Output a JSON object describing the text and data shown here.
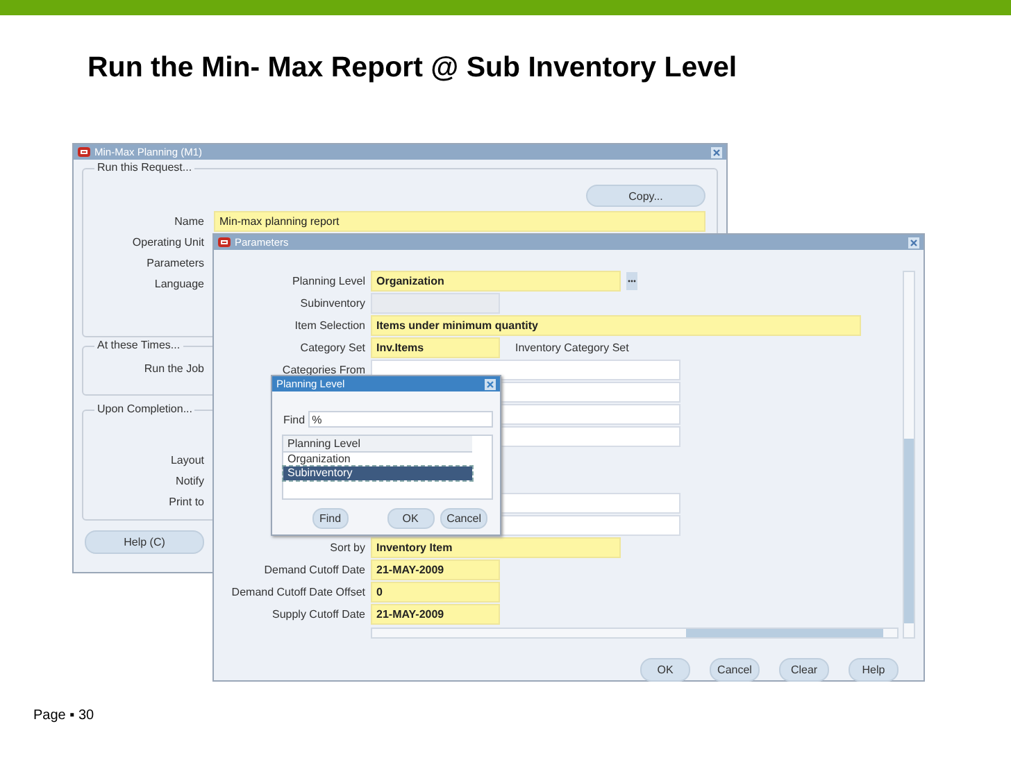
{
  "slide": {
    "title": "Run the Min- Max Report @ Sub Inventory Level",
    "footer": "Page ▪ 30"
  },
  "request_window": {
    "title": "Min-Max Planning (M1)",
    "copy_button": "Copy...",
    "help_button": "Help (C)",
    "sections": [
      {
        "heading": "Run this Request...",
        "fields": [
          {
            "label": "Name",
            "value": "Min-max planning report"
          },
          {
            "label": "Operating Unit"
          },
          {
            "label": "Parameters"
          },
          {
            "label": "Language"
          }
        ]
      },
      {
        "heading": "At these Times...",
        "fields": [
          {
            "label": "Run the Job"
          }
        ]
      },
      {
        "heading": "Upon Completion...",
        "fields": [
          {
            "label": "Layout"
          },
          {
            "label": "Notify"
          },
          {
            "label": "Print to"
          }
        ]
      }
    ]
  },
  "parameters_window": {
    "title": "Parameters",
    "rows": [
      {
        "label": "Planning Level",
        "value": "Organization",
        "required": true,
        "disabled": false,
        "kind": "medium",
        "lov": true,
        "group_start": false
      },
      {
        "label": "Subinventory",
        "required": false,
        "disabled": true,
        "kind": "short",
        "lov": false,
        "group_start": false
      },
      {
        "label": "Item Selection",
        "value": "Items under minimum quantity",
        "required": true,
        "disabled": false,
        "kind": "long",
        "lov": false,
        "group_start": false
      },
      {
        "label": "Category Set",
        "value": "Inv.Items",
        "note": "Inventory Category Set",
        "required": true,
        "disabled": false,
        "kind": "short",
        "lov": false,
        "group_start": false
      },
      {
        "label": "Categories From",
        "required": false,
        "disabled": false,
        "kind": "wide",
        "lov": false,
        "group_start": false
      },
      {
        "required": false,
        "disabled": false,
        "kind": "wide",
        "lov": false,
        "group_start": false
      },
      {
        "required": false,
        "disabled": false,
        "kind": "wide",
        "lov": false,
        "group_start": false
      },
      {
        "required": false,
        "disabled": false,
        "kind": "wide",
        "lov": false,
        "group_start": false
      },
      {
        "required": false,
        "disabled": false,
        "kind": "wide",
        "lov": false,
        "group_start": true
      },
      {
        "required": false,
        "disabled": false,
        "kind": "wide",
        "lov": false,
        "group_start": false
      },
      {
        "label": "Sort by",
        "value": "Inventory Item",
        "required": true,
        "disabled": false,
        "kind": "medium",
        "lov": false,
        "group_start": false
      },
      {
        "label": "Demand Cutoff Date",
        "value": "21-MAY-2009",
        "required": true,
        "disabled": false,
        "kind": "short",
        "lov": false,
        "group_start": false
      },
      {
        "label": "Demand Cutoff Date Offset",
        "value": "0",
        "required": true,
        "disabled": false,
        "kind": "short",
        "lov": false,
        "group_start": false
      },
      {
        "label": "Supply Cutoff Date",
        "value": "21-MAY-2009",
        "required": true,
        "disabled": false,
        "kind": "short",
        "lov": false,
        "group_start": false
      }
    ],
    "buttons": [
      "OK",
      "Cancel",
      "Clear",
      "Help"
    ]
  },
  "lov_dialog": {
    "title": "Planning Level",
    "find_label": "Find",
    "find_value": "%",
    "column": "Planning Level",
    "items": [
      {
        "label": "Organization",
        "selected": false
      },
      {
        "label": "Subinventory",
        "selected": true
      }
    ],
    "buttons": [
      "Find",
      "OK",
      "Cancel"
    ]
  }
}
